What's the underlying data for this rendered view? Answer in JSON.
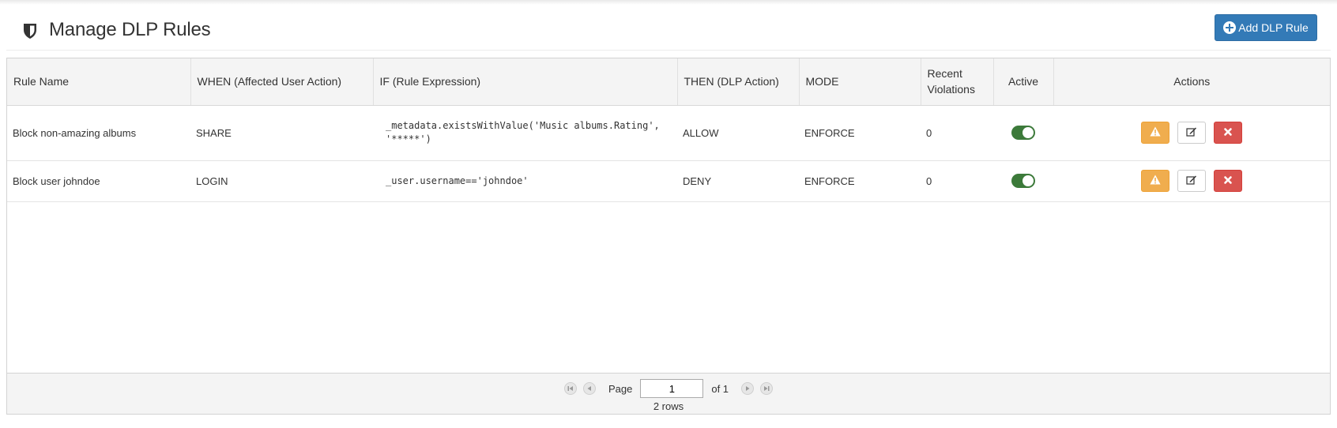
{
  "header": {
    "title": "Manage DLP Rules",
    "title_icon": "shield-icon",
    "add_button_label": "Add DLP Rule",
    "add_button_icon": "plus-circle-icon"
  },
  "table": {
    "columns": [
      "Rule Name",
      "WHEN (Affected User Action)",
      "IF (Rule Expression)",
      "THEN (DLP Action)",
      "MODE",
      "Recent Violations",
      "Active",
      "Actions"
    ],
    "rows": [
      {
        "name": "Block non-amazing albums",
        "when": "SHARE",
        "if_line1": "_metadata.existsWithValue('Music albums.Rating',",
        "if_line2": "'*****')",
        "then": "ALLOW",
        "mode": "ENFORCE",
        "violations": "0",
        "active": true
      },
      {
        "name": "Block user johndoe",
        "when": "LOGIN",
        "if_line1": "_user.username=='johndoe'",
        "if_line2": "",
        "then": "DENY",
        "mode": "ENFORCE",
        "violations": "0",
        "active": true
      }
    ]
  },
  "pager": {
    "page_label": "Page",
    "page_value": "1",
    "of_label": "of 1",
    "rows_label": "2 rows"
  },
  "colors": {
    "primary": "#337ab7",
    "warning": "#f0ad4e",
    "danger": "#d9534f",
    "toggle_on": "#3c7a3a"
  }
}
